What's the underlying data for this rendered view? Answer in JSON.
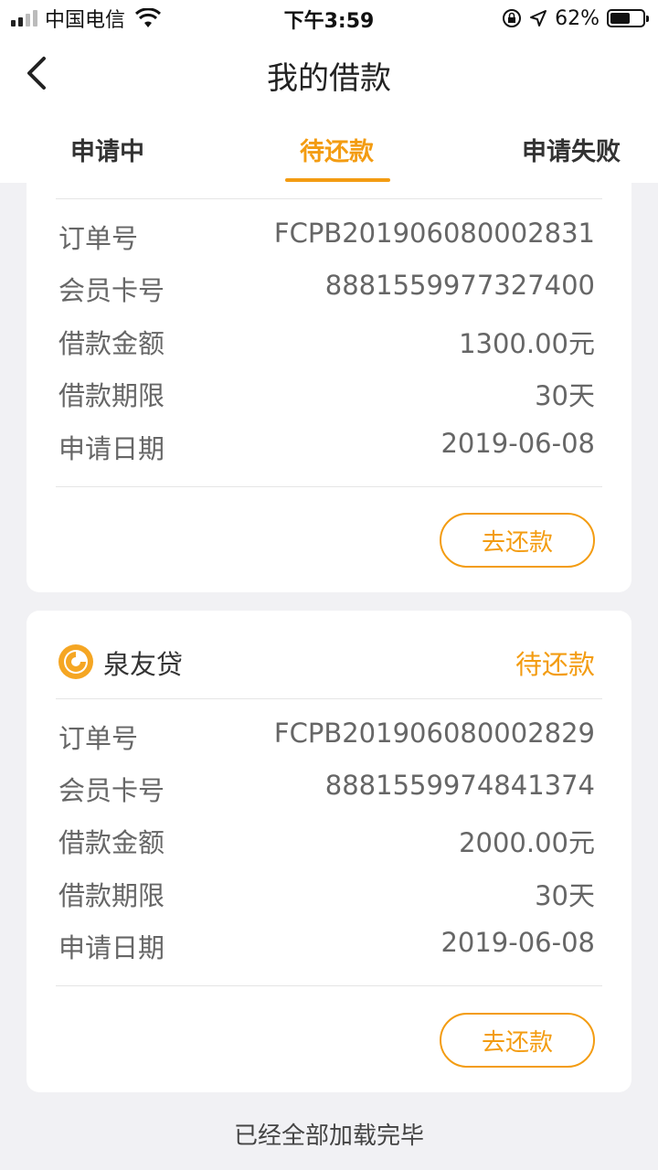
{
  "status_bar": {
    "carrier": "中国电信",
    "time": "下午3:59",
    "battery": "62%",
    "battery_level": 0.62
  },
  "nav": {
    "title": "我的借款"
  },
  "tabs": [
    {
      "label": "申请中"
    },
    {
      "label": "待还款",
      "active": true
    },
    {
      "label": "申请失败"
    }
  ],
  "loans": [
    {
      "order_label": "订单号",
      "order_no": "FCPB201906080002831",
      "card_label": "会员卡号",
      "card_no": "8881559977327400",
      "amount_label": "借款金额",
      "amount": "1300.00元",
      "term_label": "借款期限",
      "term": "30天",
      "date_label": "申请日期",
      "date": "2019-06-08",
      "button": "去还款"
    },
    {
      "brand": "泉友贷",
      "status": "待还款",
      "order_label": "订单号",
      "order_no": "FCPB201906080002829",
      "card_label": "会员卡号",
      "card_no": "8881559974841374",
      "amount_label": "借款金额",
      "amount": "2000.00元",
      "term_label": "借款期限",
      "term": "30天",
      "date_label": "申请日期",
      "date": "2019-06-08",
      "button": "去还款"
    }
  ],
  "footer": "已经全部加载完毕",
  "colors": {
    "accent": "#f39c12",
    "background": "#f1f1f4"
  }
}
